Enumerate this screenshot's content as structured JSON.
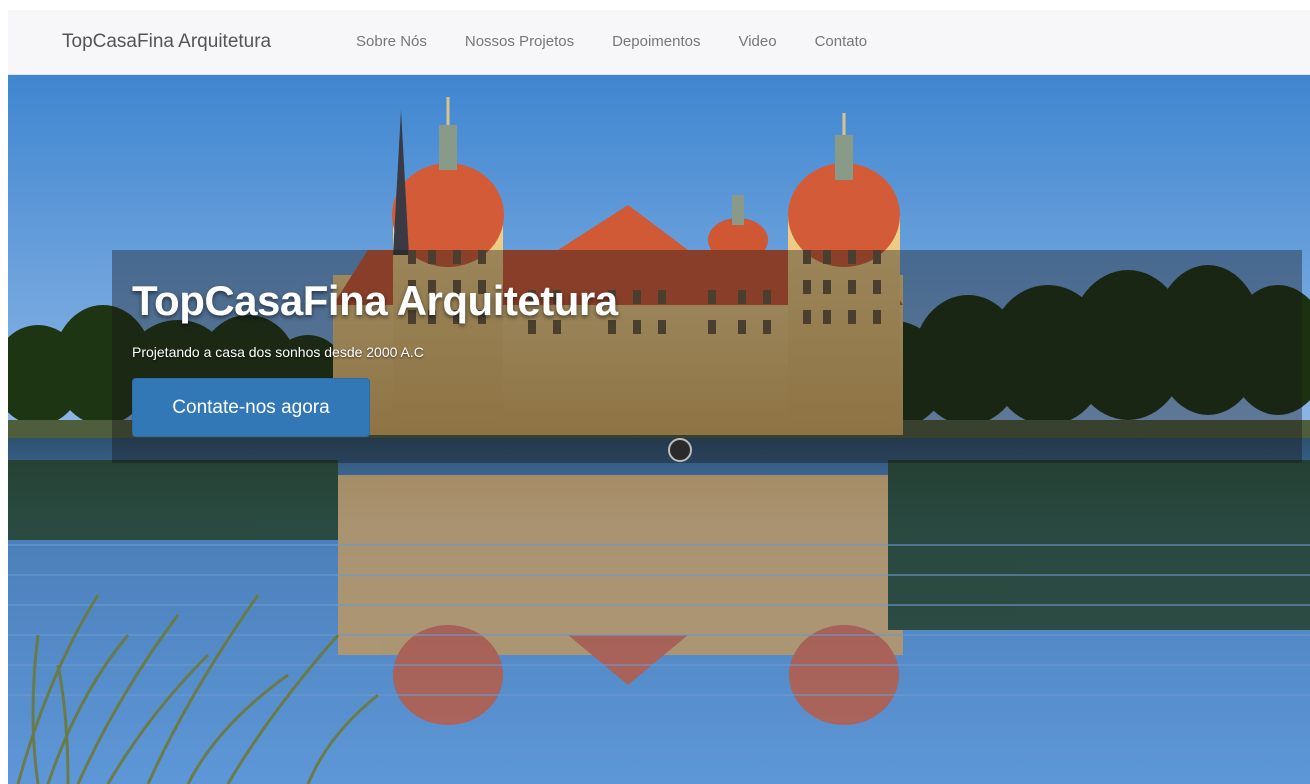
{
  "navbar": {
    "brand": "TopCasaFina Arquitetura",
    "links": [
      {
        "label": "Sobre Nós"
      },
      {
        "label": "Nossos Projetos"
      },
      {
        "label": "Depoimentos"
      },
      {
        "label": "Video"
      },
      {
        "label": "Contato"
      }
    ]
  },
  "hero": {
    "title": "TopCasaFina Arquitetura",
    "subtitle": "Projetando a casa dos sonhos desde 2000 A.C",
    "cta_label": "Contate-nos agora"
  },
  "colors": {
    "navbar_bg": "#f7f6f8",
    "cta_bg": "#3278b7",
    "sky": "#4a8fd3",
    "water": "#3a6fb0",
    "roof": "#d05a36",
    "walls": "#e9c57a"
  },
  "icons": {
    "cursor": "mouse-cursor-icon"
  }
}
